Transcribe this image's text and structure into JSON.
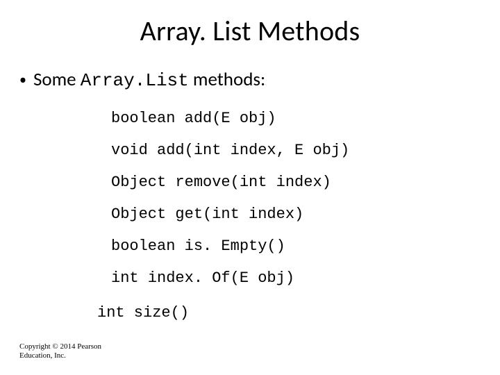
{
  "title": "Array. List Methods",
  "bullet": {
    "prefix": "Some ",
    "code": "Array.List",
    "suffix": " methods:"
  },
  "methods": {
    "m1": "boolean add(E obj)",
    "m2": "void add(int index, E obj)",
    "m3": "Object remove(int index)",
    "m4": "Object get(int index)",
    "m5": "boolean is. Empty()",
    "m6": "int index. Of(E obj)",
    "m7": "int size()"
  },
  "copyright": {
    "line1": "Copyright © 2014 Pearson",
    "line2": "Education, Inc."
  }
}
